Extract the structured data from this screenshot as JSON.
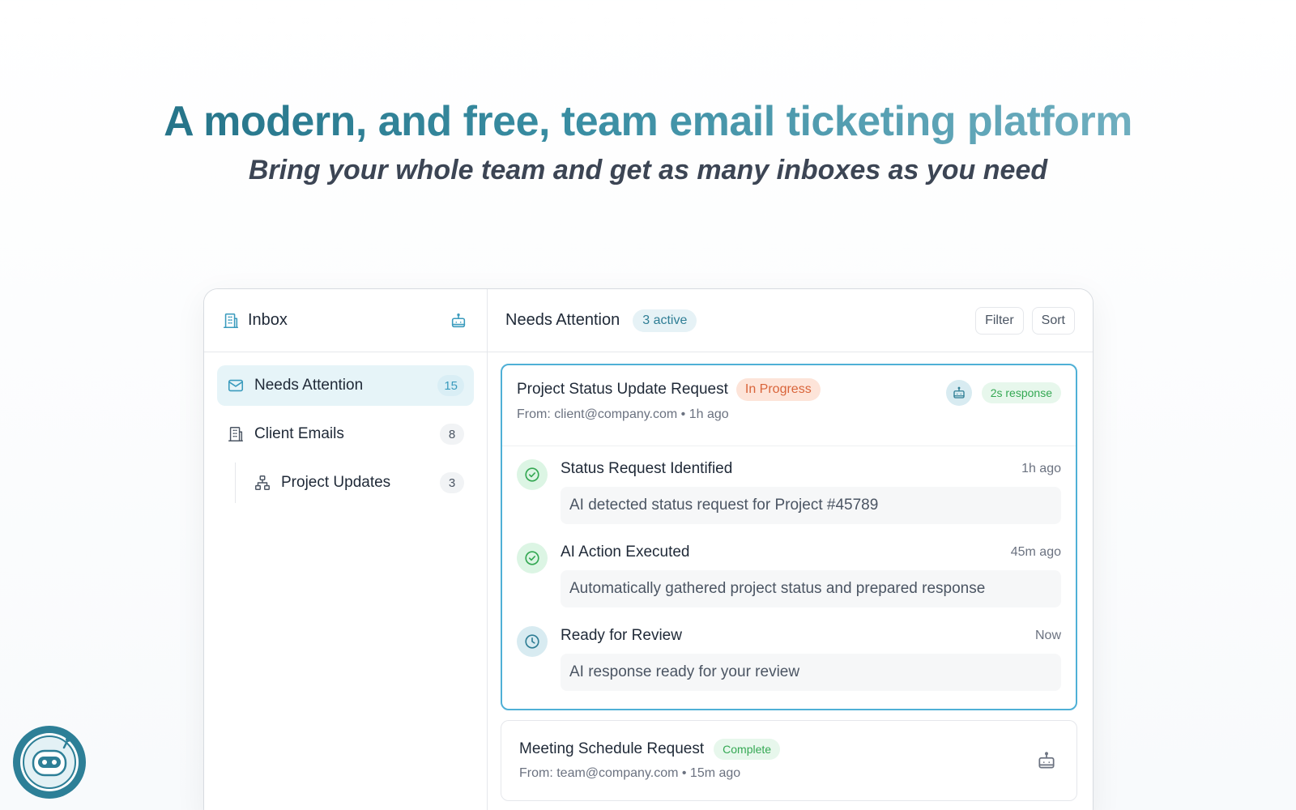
{
  "hero": {
    "title": "A modern, and free, team email ticketing platform",
    "subtitle": "Bring your whole team and get as many inboxes as you need"
  },
  "sidebar": {
    "header": {
      "title": "Inbox",
      "icon": "building-icon",
      "action_icon": "bot-icon"
    },
    "items": [
      {
        "label": "Needs Attention",
        "count": "15",
        "icon": "mail-icon",
        "active": true
      },
      {
        "label": "Client Emails",
        "count": "8",
        "icon": "building-icon",
        "active": false
      },
      {
        "label": "Project Updates",
        "count": "3",
        "icon": "network-icon",
        "active": false
      }
    ]
  },
  "main": {
    "header": {
      "title": "Needs Attention",
      "active_badge": "3 active",
      "filter_label": "Filter",
      "sort_label": "Sort"
    },
    "tickets": [
      {
        "title": "Project Status Update Request",
        "status": "In Progress",
        "meta": "From: client@company.com • 1h ago",
        "response": "2s response",
        "steps": [
          {
            "title": "Status Request Identified",
            "time": "1h ago",
            "desc": "AI detected status request for Project #45789",
            "state": "done"
          },
          {
            "title": "AI Action Executed",
            "time": "45m ago",
            "desc": "Automatically gathered project status and prepared response",
            "state": "done"
          },
          {
            "title": "Ready for Review",
            "time": "Now",
            "desc": "AI response ready for your review",
            "state": "pending"
          }
        ]
      },
      {
        "title": "Meeting Schedule Request",
        "status": "Complete",
        "meta": "From: team@company.com • 15m ago"
      }
    ]
  },
  "colors": {
    "accent": "#4fb0d6",
    "in_progress_bg": "#fde4d9",
    "in_progress_text": "#d9643a",
    "complete_bg": "#e7f7ec",
    "complete_text": "#34a853"
  }
}
